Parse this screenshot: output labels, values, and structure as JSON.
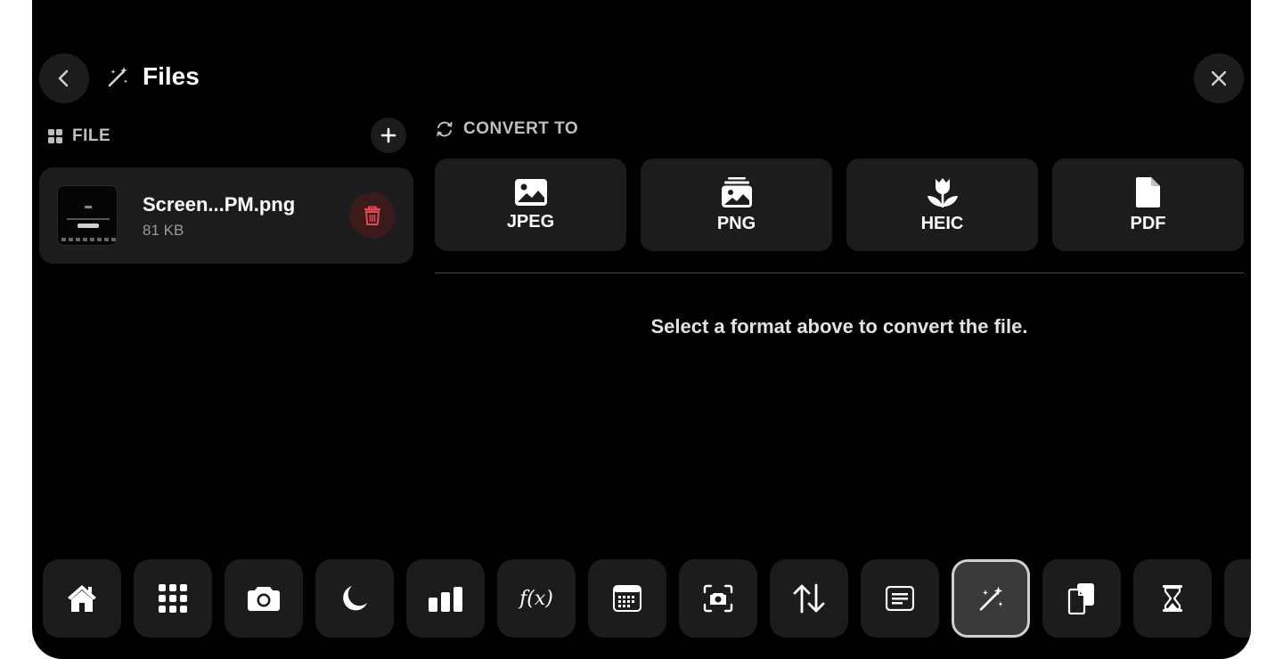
{
  "header": {
    "title": "Files"
  },
  "file_section": {
    "label": "FILE",
    "file": {
      "name": "Screen...PM.png",
      "size": "81 KB"
    }
  },
  "convert_section": {
    "label": "CONVERT TO",
    "formats": [
      {
        "label": "JPEG",
        "icon": "photo-icon"
      },
      {
        "label": "PNG",
        "icon": "photo-stack-icon"
      },
      {
        "label": "HEIC",
        "icon": "tulip-icon"
      },
      {
        "label": "PDF",
        "icon": "document-icon"
      }
    ],
    "hint": "Select a format above to convert the file."
  },
  "dock": {
    "items": [
      {
        "name": "home",
        "icon": "house-icon"
      },
      {
        "name": "apps",
        "icon": "grid-icon"
      },
      {
        "name": "camera",
        "icon": "camera-icon"
      },
      {
        "name": "sleep",
        "icon": "moon-icon"
      },
      {
        "name": "stats",
        "icon": "bar-chart-icon"
      },
      {
        "name": "functions",
        "icon": "function-icon",
        "glyph": "f(x)"
      },
      {
        "name": "calendar",
        "icon": "calendar-icon"
      },
      {
        "name": "screenshot",
        "icon": "screenshot-icon"
      },
      {
        "name": "sort",
        "icon": "arrows-up-down-icon"
      },
      {
        "name": "text",
        "icon": "text-box-icon"
      },
      {
        "name": "files",
        "icon": "magic-wand-icon",
        "active": true
      },
      {
        "name": "documents",
        "icon": "documents-icon"
      },
      {
        "name": "timer",
        "icon": "hourglass-icon"
      }
    ]
  },
  "colors": {
    "background": "#000000",
    "card": "#1c1c1e",
    "danger": "#e5484d",
    "text_secondary": "#9a9a9a"
  }
}
